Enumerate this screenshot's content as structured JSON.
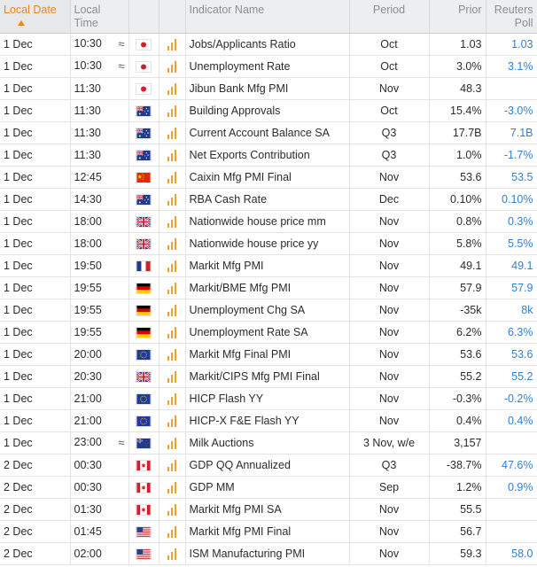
{
  "headers": {
    "local_date": "Local Date",
    "local_time": "Local Time",
    "indicator": "Indicator Name",
    "period": "Period",
    "prior": "Prior",
    "poll": "Reuters Poll"
  },
  "colors": {
    "accent": "#e8862a",
    "poll_blue": "#2f7fd0",
    "bars_orange": "#f0a030"
  },
  "rows": [
    {
      "date": "1 Dec",
      "time": "10:30",
      "approx": true,
      "flag": "jp",
      "name": "Jobs/Applicants Ratio",
      "period": "Oct",
      "prior": "1.03",
      "poll": "1.03"
    },
    {
      "date": "1 Dec",
      "time": "10:30",
      "approx": true,
      "flag": "jp",
      "name": "Unemployment Rate",
      "period": "Oct",
      "prior": "3.0%",
      "poll": "3.1%"
    },
    {
      "date": "1 Dec",
      "time": "11:30",
      "approx": false,
      "flag": "jp",
      "name": "Jibun Bank Mfg PMI",
      "period": "Nov",
      "prior": "48.3",
      "poll": ""
    },
    {
      "date": "1 Dec",
      "time": "11:30",
      "approx": false,
      "flag": "au",
      "name": "Building Approvals",
      "period": "Oct",
      "prior": "15.4%",
      "poll": "-3.0%"
    },
    {
      "date": "1 Dec",
      "time": "11:30",
      "approx": false,
      "flag": "au",
      "name": "Current Account Balance SA",
      "period": "Q3",
      "prior": "17.7B",
      "poll": "7.1B"
    },
    {
      "date": "1 Dec",
      "time": "11:30",
      "approx": false,
      "flag": "au",
      "name": "Net Exports Contribution",
      "period": "Q3",
      "prior": "1.0%",
      "poll": "-1.7%"
    },
    {
      "date": "1 Dec",
      "time": "12:45",
      "approx": false,
      "flag": "cn",
      "name": "Caixin Mfg PMI Final",
      "period": "Nov",
      "prior": "53.6",
      "poll": "53.5"
    },
    {
      "date": "1 Dec",
      "time": "14:30",
      "approx": false,
      "flag": "au",
      "name": "RBA Cash Rate",
      "period": "Dec",
      "prior": "0.10%",
      "poll": "0.10%"
    },
    {
      "date": "1 Dec",
      "time": "18:00",
      "approx": false,
      "flag": "gb",
      "name": "Nationwide house price mm",
      "period": "Nov",
      "prior": "0.8%",
      "poll": "0.3%"
    },
    {
      "date": "1 Dec",
      "time": "18:00",
      "approx": false,
      "flag": "gb",
      "name": "Nationwide house price yy",
      "period": "Nov",
      "prior": "5.8%",
      "poll": "5.5%"
    },
    {
      "date": "1 Dec",
      "time": "19:50",
      "approx": false,
      "flag": "fr",
      "name": "Markit Mfg PMI",
      "period": "Nov",
      "prior": "49.1",
      "poll": "49.1"
    },
    {
      "date": "1 Dec",
      "time": "19:55",
      "approx": false,
      "flag": "de",
      "name": "Markit/BME Mfg PMI",
      "period": "Nov",
      "prior": "57.9",
      "poll": "57.9"
    },
    {
      "date": "1 Dec",
      "time": "19:55",
      "approx": false,
      "flag": "de",
      "name": "Unemployment Chg SA",
      "period": "Nov",
      "prior": "-35k",
      "poll": "8k"
    },
    {
      "date": "1 Dec",
      "time": "19:55",
      "approx": false,
      "flag": "de",
      "name": "Unemployment Rate SA",
      "period": "Nov",
      "prior": "6.2%",
      "poll": "6.3%"
    },
    {
      "date": "1 Dec",
      "time": "20:00",
      "approx": false,
      "flag": "eu",
      "name": "Markit Mfg Final PMI",
      "period": "Nov",
      "prior": "53.6",
      "poll": "53.6"
    },
    {
      "date": "1 Dec",
      "time": "20:30",
      "approx": false,
      "flag": "gb",
      "name": "Markit/CIPS Mfg PMI Final",
      "period": "Nov",
      "prior": "55.2",
      "poll": "55.2"
    },
    {
      "date": "1 Dec",
      "time": "21:00",
      "approx": false,
      "flag": "eu",
      "name": "HICP Flash YY",
      "period": "Nov",
      "prior": "-0.3%",
      "poll": "-0.2%"
    },
    {
      "date": "1 Dec",
      "time": "21:00",
      "approx": false,
      "flag": "eu",
      "name": "HICP-X F&E Flash YY",
      "period": "Nov",
      "prior": "0.4%",
      "poll": "0.4%"
    },
    {
      "date": "1 Dec",
      "time": "23:00",
      "approx": true,
      "flag": "nz",
      "name": "Milk Auctions",
      "period": "3 Nov, w/e",
      "prior": "3,157",
      "poll": ""
    },
    {
      "date": "2 Dec",
      "time": "00:30",
      "approx": false,
      "flag": "ca",
      "name": "GDP QQ Annualized",
      "period": "Q3",
      "prior": "-38.7%",
      "poll": "47.6%"
    },
    {
      "date": "2 Dec",
      "time": "00:30",
      "approx": false,
      "flag": "ca",
      "name": "GDP MM",
      "period": "Sep",
      "prior": "1.2%",
      "poll": "0.9%"
    },
    {
      "date": "2 Dec",
      "time": "01:30",
      "approx": false,
      "flag": "ca",
      "name": "Markit Mfg PMI SA",
      "period": "Nov",
      "prior": "55.5",
      "poll": ""
    },
    {
      "date": "2 Dec",
      "time": "01:45",
      "approx": false,
      "flag": "us",
      "name": "Markit Mfg PMI Final",
      "period": "Nov",
      "prior": "56.7",
      "poll": ""
    },
    {
      "date": "2 Dec",
      "time": "02:00",
      "approx": false,
      "flag": "us",
      "name": "ISM Manufacturing PMI",
      "period": "Nov",
      "prior": "59.3",
      "poll": "58.0"
    }
  ]
}
